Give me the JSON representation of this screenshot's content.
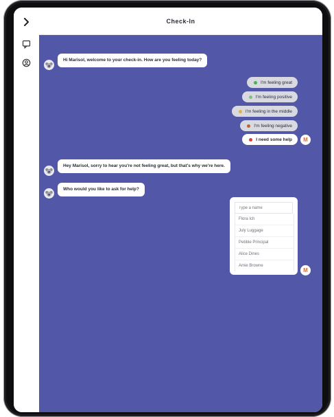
{
  "header": {
    "title": "Check-In"
  },
  "sidebar": {
    "icons": [
      "chevron-right-icon",
      "chat-icon",
      "user-circle-icon"
    ]
  },
  "messages": {
    "welcome": "Hi Marisol, welcome to your check-in. How are you feeling today?",
    "sorry": "Hey Marisol, sorry to hear you're not feeling great, but that's why we're here.",
    "ask_help": "Who would you like to ask for help?"
  },
  "options": [
    {
      "label": "I'm feeling great",
      "color": "#4caf50",
      "selected": false
    },
    {
      "label": "I'm feeling positive",
      "color": "#7bc47f",
      "selected": false
    },
    {
      "label": "I'm feeling in the middle",
      "color": "#d9b44a",
      "selected": false
    },
    {
      "label": "I'm feeling negative",
      "color": "#b8653a",
      "selected": false
    },
    {
      "label": "I need some help",
      "color": "#e53935",
      "selected": true
    }
  ],
  "user_avatar": {
    "initial": "M"
  },
  "name_picker": {
    "placeholder": "Type a name",
    "names": [
      "Flora Ich",
      "July Luggage",
      "Pebble Principal",
      "Alice Dines",
      "Amie Browne"
    ]
  },
  "colors": {
    "chat_bg": "#5357a7",
    "accent": "#e26b2f"
  }
}
